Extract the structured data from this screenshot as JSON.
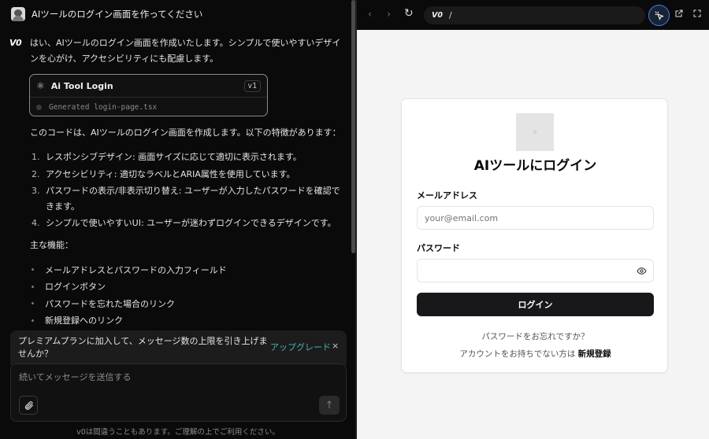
{
  "chat": {
    "user_message": "AIツールのログイン画面を作ってください",
    "assistant_logo": "V0",
    "intro": "はい、AIツールのログイン画面を作成いたします。シンプルで使いやすいデザインを心がけ、アクセシビリティにも配慮します。",
    "card": {
      "title": "Ai Tool Login",
      "version": "v1",
      "file_status": "Generated login-page.tsx"
    },
    "description": "このコードは、AIツールのログイン画面を作成します。以下の特徴があります：",
    "features_list": [
      {
        "num": "1.",
        "text": "レスポンシブデザイン: 画面サイズに応じて適切に表示されます。"
      },
      {
        "num": "2.",
        "text": "アクセシビリティ: 適切なラベルとARIA属性を使用しています。"
      },
      {
        "num": "3.",
        "text": "パスワードの表示/非表示切り替え: ユーザーが入力したパスワードを確認できます。"
      },
      {
        "num": "4.",
        "text": "シンプルで使いやすいUI: ユーザーが迷わずログインできるデザインです。"
      }
    ],
    "main_features_label": "主な機能：",
    "main_features": [
      "メールアドレスとパスワードの入力フィールド",
      "ログインボタン",
      "パスワードを忘れた場合のリンク",
      "新規登録へのリンク"
    ],
    "upgrade_banner": {
      "text": "プレミアムプランに加入して、メッセージ数の上限を引き上げませんか？",
      "link": "アップグレード",
      "close": "×"
    },
    "input_placeholder": "続いてメッセージを送信する",
    "send_icon": "↑",
    "disclaimer": "v0は間違うこともあります。ご理解の上でご利用ください。"
  },
  "preview": {
    "toolbar": {
      "back": "‹",
      "forward": "›",
      "reload": "↻",
      "url_logo": "V0",
      "url_path": "/"
    },
    "login": {
      "title": "AIツールにログイン",
      "email_label": "メールアドレス",
      "email_placeholder": "your@email.com",
      "password_label": "パスワード",
      "password_value": "",
      "login_button": "ログイン",
      "forgot_link": "パスワードをお忘れですか？",
      "signup_prefix": "アカウントをお持ちでない方は",
      "signup_link": "新規登録"
    }
  },
  "colors": {
    "accent_blue": "#3b82f6",
    "upgrade_link": "#4fb0b0",
    "login_button_bg": "#18181b"
  }
}
